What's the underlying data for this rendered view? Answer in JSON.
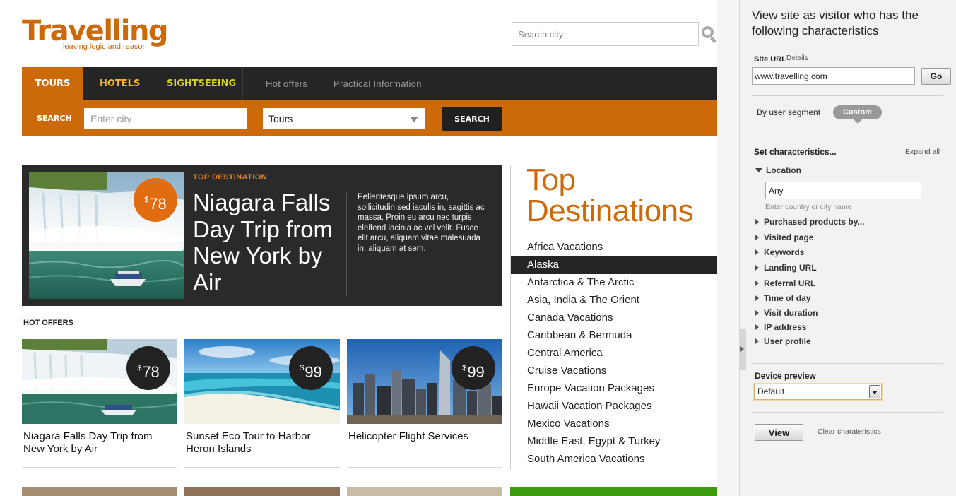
{
  "site": {
    "logo_title": "Travelling",
    "logo_tagline": "leaving logic and reason",
    "top_search_placeholder": "Search city",
    "nav": {
      "tours": "TOURS",
      "hotels": "HOTELS",
      "sightseeing": "SIGHTSEEING",
      "hot_offers": "Hot offers",
      "practical_info": "Practical Information"
    },
    "search_bar": {
      "label": "SEARCH",
      "city_placeholder": "Enter city",
      "type_selected": "Tours",
      "button": "SEARCH"
    },
    "feature": {
      "kicker": "TOP DESTINATION",
      "currency": "$",
      "price": "78",
      "title": "Niagara Falls Day Trip from New York by Air",
      "description": "Pellentesque ipsum arcu, sollicitudin sed iaculis in, sagittis ac massa. Proin eu arcu nec turpis eleifend lacinia ac vel velit. Fusce elit arcu, aliquam vitae malesuada in, aliquam at sem."
    },
    "hot_offers": {
      "heading": "HOT OFFERS",
      "cards": [
        {
          "currency": "$",
          "price": "78",
          "title": "Niagara Falls Day Trip from New York by Air"
        },
        {
          "currency": "$",
          "price": "99",
          "title": "Sunset Eco Tour to Harbor Heron Islands"
        },
        {
          "currency": "$",
          "price": "99",
          "title": "Helicopter Flight Services"
        }
      ]
    },
    "destinations": {
      "title_line1": "Top",
      "title_line2": "Destinations",
      "items": [
        "Africa Vacations",
        "Alaska",
        "Antarctica & The Arctic",
        "Asia, India & The Orient",
        "Canada Vacations",
        "Caribbean & Bermuda",
        "Central America",
        "Cruise Vacations",
        "Europe Vacation Packages",
        "Hawaii Vacation Packages",
        "Mexico Vacations",
        "Middle East, Egypt & Turkey",
        "South America Vacations"
      ],
      "active_index": 1
    }
  },
  "panel": {
    "heading": "View site as visitor who has the following characteristics",
    "site_url_label": "Site URL",
    "details_link": "Details",
    "site_url_value": "www.travelling.com",
    "go_button": "Go",
    "segment_label": "By user segment",
    "custom_pill": "Custom",
    "set_characteristics": "Set characteristics...",
    "expand_all": "Expand all",
    "location": {
      "label": "Location",
      "value": "Any",
      "hint": "Enter country or city name"
    },
    "criteria": [
      "Purchased products by...",
      "Visited page",
      "Keywords",
      "Landing URL",
      "Referral URL",
      "Time of day",
      "Visit duration",
      "IP address",
      "User profile"
    ],
    "device_preview_label": "Device preview",
    "device_selected": "Default",
    "view_button": "View",
    "clear_link": "Clear charateristics"
  },
  "colors": {
    "brand_orange": "#cc6a0a",
    "nav_dark": "#252525",
    "badge_orange": "#e16d10",
    "panel_bg": "#f2f2f2"
  }
}
